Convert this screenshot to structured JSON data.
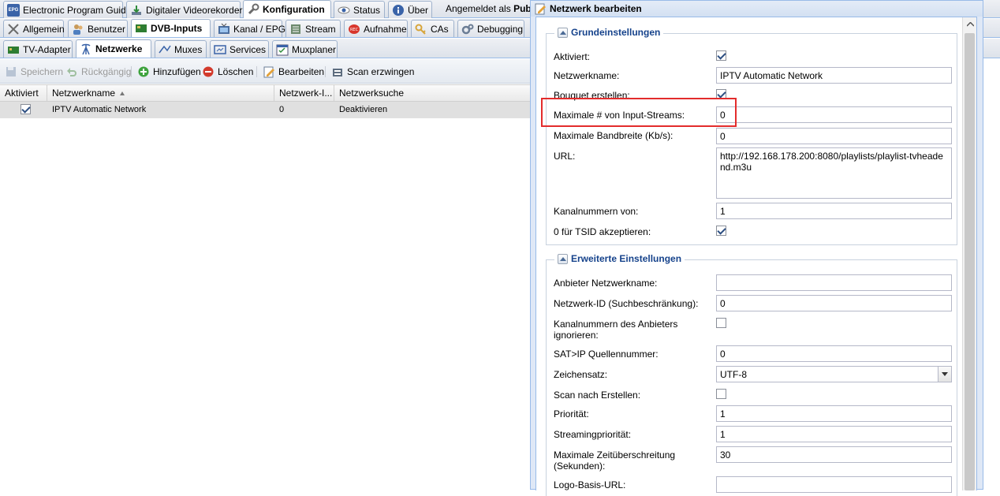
{
  "main_tabs": [
    "Electronic Program Guide",
    "Digitaler Videorekorder",
    "Konfiguration",
    "Status",
    "Über"
  ],
  "logged_in": {
    "prefix": "Angemeldet als",
    "user": "Publi"
  },
  "config_tabs": [
    "Allgemein",
    "Benutzer",
    "DVB-Inputs",
    "Kanal / EPG",
    "Stream",
    "Aufnahme",
    "CAs",
    "Debugging"
  ],
  "dvb_tabs": [
    "TV-Adapter",
    "Netzwerke",
    "Muxes",
    "Services",
    "Muxplaner"
  ],
  "toolbar": {
    "save": "Speichern",
    "undo": "Rückgängig",
    "add": "Hinzufügen",
    "delete": "Löschen",
    "edit": "Bearbeiten",
    "force_scan": "Scan erzwingen"
  },
  "grid": {
    "columns": [
      "Aktiviert",
      "Netzwerkname",
      "Netzwerk-I...",
      "Netzwerksuche"
    ],
    "rows": [
      {
        "enabled": true,
        "name": "IPTV Automatic Network",
        "id": "0",
        "search": "Deaktivieren"
      }
    ]
  },
  "dialog": {
    "title": "Netzwerk bearbeiten",
    "basic": {
      "legend": "Grundeinstellungen",
      "enabled_label": "Aktiviert:",
      "name_label": "Netzwerkname:",
      "name_value": "IPTV Automatic Network",
      "bouquet_label": "Bouquet erstellen:",
      "max_streams_label": "Maximale # von Input-Streams:",
      "max_streams_value": "0",
      "max_bw_label": "Maximale Bandbreite (Kb/s):",
      "max_bw_value": "0",
      "url_label": "URL:",
      "url_value": "http://192.168.178.200:8080/playlists/playlist-tvheadend.m3u",
      "chnum_label": "Kanalnummern von:",
      "chnum_value": "1",
      "tsid_label": "0 für TSID akzeptieren:"
    },
    "advanced": {
      "legend": "Erweiterte Einstellungen",
      "provider_label": "Anbieter Netzwerkname:",
      "provider_value": "",
      "netid_label": "Netzwerk-ID (Suchbeschränkung):",
      "netid_value": "0",
      "ignore_label": "Kanalnummern des Anbieters ignorieren:",
      "satip_label": "SAT>IP Quellennummer:",
      "satip_value": "0",
      "charset_label": "Zeichensatz:",
      "charset_value": "UTF-8",
      "scan_label": "Scan nach Erstellen:",
      "priority_label": "Priorität:",
      "priority_value": "1",
      "stream_prio_label": "Streamingpriorität:",
      "stream_prio_value": "1",
      "timeout_label": "Maximale Zeitüberschreitung (Sekunden):",
      "timeout_value": "30",
      "logo_label": "Logo-Basis-URL:",
      "logo_value": ""
    }
  }
}
